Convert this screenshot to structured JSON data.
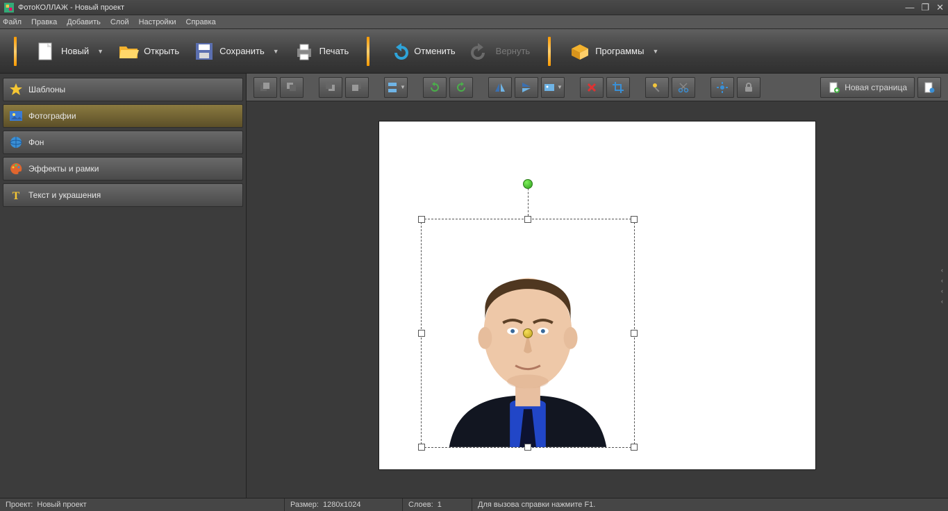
{
  "title": "ФотоКОЛЛАЖ - Новый проект",
  "winctl": {
    "min": "—",
    "max": "❐",
    "close": "✕"
  },
  "menu": [
    "Файл",
    "Правка",
    "Добавить",
    "Слой",
    "Настройки",
    "Справка"
  ],
  "toolbar": {
    "new": "Новый",
    "open": "Открыть",
    "save": "Сохранить",
    "print": "Печать",
    "undo": "Отменить",
    "redo": "Вернуть",
    "programs": "Программы"
  },
  "sidebar": {
    "items": [
      {
        "label": "Шаблоны",
        "active": false
      },
      {
        "label": "Фотографии",
        "active": true
      },
      {
        "label": "Фон",
        "active": false
      },
      {
        "label": "Эффекты и рамки",
        "active": false
      },
      {
        "label": "Текст и украшения",
        "active": false
      }
    ]
  },
  "sectoolbar": {
    "new_page": "Новая страница"
  },
  "status": {
    "project_label": "Проект:",
    "project_value": "Новый проект",
    "size_label": "Размер:",
    "size_value": "1280x1024",
    "layers_label": "Слоев:",
    "layers_value": "1",
    "help": "Для вызова справки нажмите F1."
  }
}
